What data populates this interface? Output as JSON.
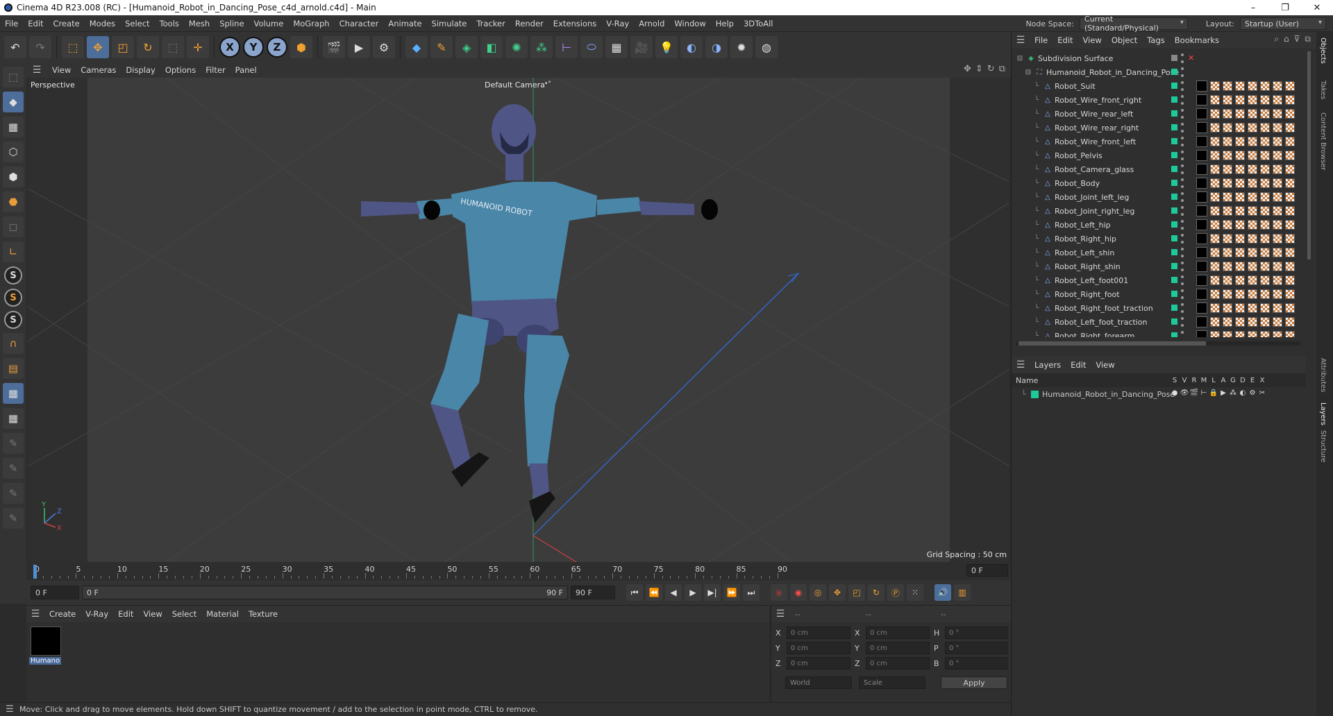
{
  "window": {
    "title": "Cinema 4D R23.008 (RC) - [Humanoid_Robot_in_Dancing_Pose_c4d_arnold.c4d] - Main",
    "controls": [
      "–",
      "❐",
      "✕"
    ]
  },
  "menubar": {
    "items": [
      "File",
      "Edit",
      "Create",
      "Modes",
      "Select",
      "Tools",
      "Mesh",
      "Spline",
      "Volume",
      "MoGraph",
      "Character",
      "Animate",
      "Simulate",
      "Tracker",
      "Render",
      "Extensions",
      "V-Ray",
      "Arnold",
      "Window",
      "Help",
      "3DToAll"
    ],
    "node_space_label": "Node Space:",
    "node_space_value": "Current (Standard/Physical)",
    "layout_label": "Layout:",
    "layout_value": "Startup (User)"
  },
  "toolbar": {
    "axis_x": "X",
    "axis_y": "Y",
    "axis_z": "Z"
  },
  "viewport": {
    "menu": [
      "View",
      "Cameras",
      "Display",
      "Options",
      "Filter",
      "Panel"
    ],
    "view_name": "Perspective",
    "camera_name": "Default Camera",
    "camera_badge": "•°",
    "grid_spacing": "Grid Spacing : 50 cm",
    "shirt_text": "HUMANOID ROBOT",
    "axis_y_label": "Y",
    "axis_z_label": "Z",
    "axis_x_label": "X"
  },
  "timeline": {
    "ticks": [
      "0",
      "5",
      "10",
      "15",
      "20",
      "25",
      "30",
      "35",
      "40",
      "45",
      "50",
      "55",
      "60",
      "65",
      "70",
      "75",
      "80",
      "85",
      "90"
    ],
    "current_frame_right": "0 F"
  },
  "playbar": {
    "start_field": "0 F",
    "range_start": "0 F",
    "range_end": "90 F",
    "end_field": "90 F"
  },
  "material_panel": {
    "menu": [
      "Create",
      "V-Ray",
      "Edit",
      "View",
      "Select",
      "Material",
      "Texture"
    ],
    "material_name": "Humano"
  },
  "coord_panel": {
    "header_dashes": [
      "--",
      "--",
      "--"
    ],
    "rows": [
      {
        "a": "X",
        "av": "0 cm",
        "b": "X",
        "bv": "0 cm",
        "c": "H",
        "cv": "0 °"
      },
      {
        "a": "Y",
        "av": "0 cm",
        "b": "Y",
        "bv": "0 cm",
        "c": "P",
        "cv": "0 °"
      },
      {
        "a": "Z",
        "av": "0 cm",
        "b": "Z",
        "bv": "0 cm",
        "c": "B",
        "cv": "0 °"
      }
    ],
    "world": "World",
    "scale": "Scale",
    "apply": "Apply"
  },
  "status": {
    "text": "Move: Click and drag to move elements. Hold down SHIFT to quantize movement / add to the selection in point mode, CTRL to remove."
  },
  "objects": {
    "menu": [
      "File",
      "Edit",
      "View",
      "Object",
      "Tags",
      "Bookmarks"
    ],
    "root": "Subdivision Surface",
    "group": "Humanoid_Robot_in_Dancing_Pose",
    "items": [
      "Robot_Suit",
      "Robot_Wire_front_right",
      "Robot_Wire_rear_left",
      "Robot_Wire_rear_right",
      "Robot_Wire_front_left",
      "Robot_Pelvis",
      "Robot_Camera_glass",
      "Robot_Body",
      "Robot_Joint_left_leg",
      "Robot_Joint_right_leg",
      "Robot_Left_hip",
      "Robot_Right_hip",
      "Robot_Left_shin",
      "Robot_Right_shin",
      "Robot_Left_foot001",
      "Robot_Right_foot",
      "Robot_Right_foot_traction",
      "Robot_Left_foot_traction",
      "Robot_Right_forearm"
    ]
  },
  "layers": {
    "menu": [
      "Layers",
      "Edit",
      "View"
    ],
    "name_header": "Name",
    "cols": [
      "S",
      "V",
      "R",
      "M",
      "L",
      "A",
      "G",
      "D",
      "E",
      "X"
    ],
    "row_name": "Humanoid_Robot_in_Dancing_Pose"
  },
  "side_tabs": [
    "Objects",
    "Takes",
    "Content Browser",
    "Attributes",
    "Layers",
    "Structure"
  ],
  "colors": {
    "accent": "#4d6e9b",
    "layer_green": "#1fc99a",
    "suit_blue": "#4a86a8",
    "robot_purple": "#4f5585"
  }
}
